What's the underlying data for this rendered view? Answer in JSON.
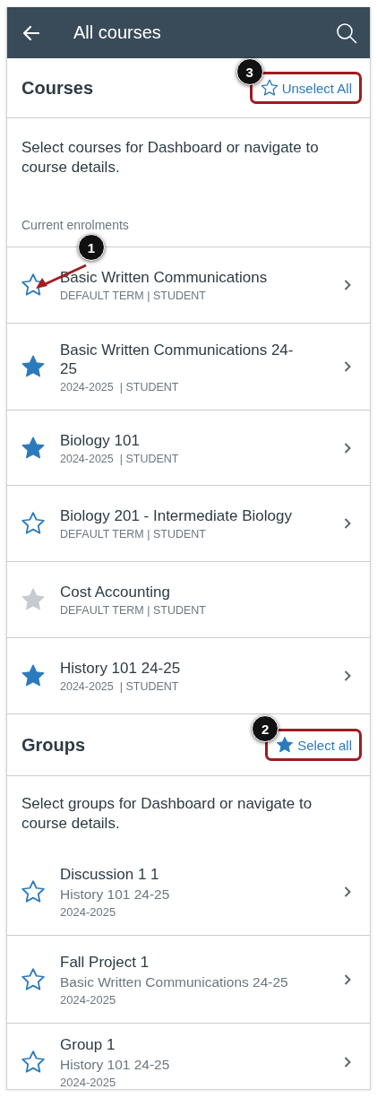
{
  "app_bar": {
    "title": "All courses"
  },
  "courses_section": {
    "title": "Courses",
    "action": {
      "label": "Unselect All",
      "filled": false,
      "callout": "3"
    },
    "description": "Select courses for Dashboard or navigate to course details.",
    "subheading": "Current enrolments"
  },
  "courses": [
    {
      "title": "Basic Written Communications",
      "subtitle": "DEFAULT TERM | STUDENT",
      "favorite": false,
      "disabled": false,
      "callout": "1"
    },
    {
      "title": "Basic Written Communications 24-25",
      "subtitle": "2024-2025  | STUDENT",
      "favorite": true,
      "disabled": false
    },
    {
      "title": "Biology 101",
      "subtitle": "2024-2025  | STUDENT",
      "favorite": true,
      "disabled": false
    },
    {
      "title": "Biology 201 - Intermediate Biology",
      "subtitle": "DEFAULT TERM | STUDENT",
      "favorite": false,
      "disabled": false
    },
    {
      "title": "Cost Accounting",
      "subtitle": "DEFAULT TERM | STUDENT",
      "favorite": true,
      "disabled": true
    },
    {
      "title": "History 101 24-25",
      "subtitle": "2024-2025  | STUDENT",
      "favorite": true,
      "disabled": false
    }
  ],
  "groups_section": {
    "title": "Groups",
    "action": {
      "label": "Select all",
      "filled": true,
      "callout": "2"
    },
    "description": "Select groups for Dashboard or navigate to course details."
  },
  "groups": [
    {
      "title": "Discussion 1 1",
      "course": "History 101 24-25",
      "term": "2024-2025",
      "favorite": false,
      "disabled": false
    },
    {
      "title": "Fall Project 1",
      "course": "Basic Written Communications 24-25",
      "term": "2024-2025",
      "favorite": false,
      "disabled": false
    },
    {
      "title": "Group 1",
      "course": "History 101 24-25",
      "term": "2024-2025",
      "favorite": false,
      "disabled": false
    }
  ]
}
